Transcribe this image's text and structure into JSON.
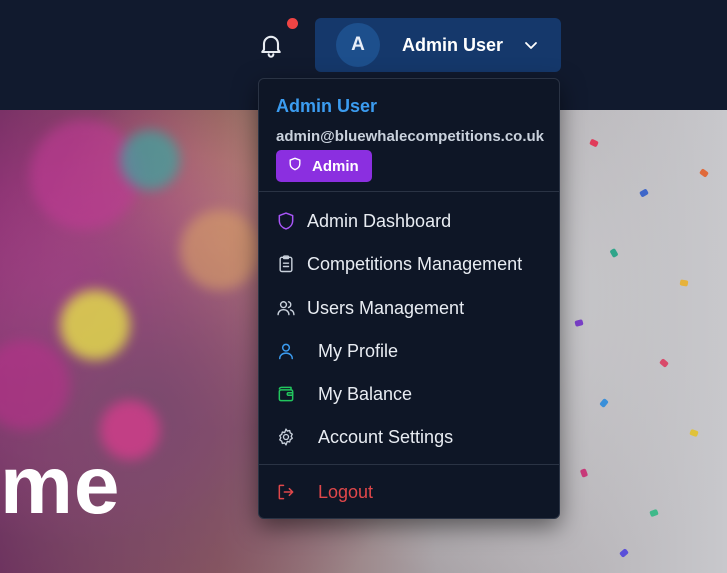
{
  "header": {
    "user_button": {
      "avatar_initial": "A",
      "name": "Admin User"
    },
    "notification_dot_color": "#ef4444"
  },
  "hero": {
    "heading_fragment": "me"
  },
  "dropdown": {
    "name": "Admin User",
    "email": "admin@bluewhalecompetitions.co.uk",
    "role_badge": "Admin",
    "items": [
      {
        "label": "Admin Dashboard",
        "icon": "shield-icon"
      },
      {
        "label": "Competitions Management",
        "icon": "clipboard-icon"
      },
      {
        "label": "Users Management",
        "icon": "users-icon"
      },
      {
        "label": "My Profile",
        "icon": "user-icon"
      },
      {
        "label": "My Balance",
        "icon": "wallet-icon"
      },
      {
        "label": "Account Settings",
        "icon": "gear-icon"
      }
    ],
    "logout_label": "Logout"
  },
  "colors": {
    "accent_blue": "#3b9cf0",
    "admin_purple": "#8b2fe0",
    "logout_red": "#e0474a",
    "wallet_green": "#22c55e"
  }
}
